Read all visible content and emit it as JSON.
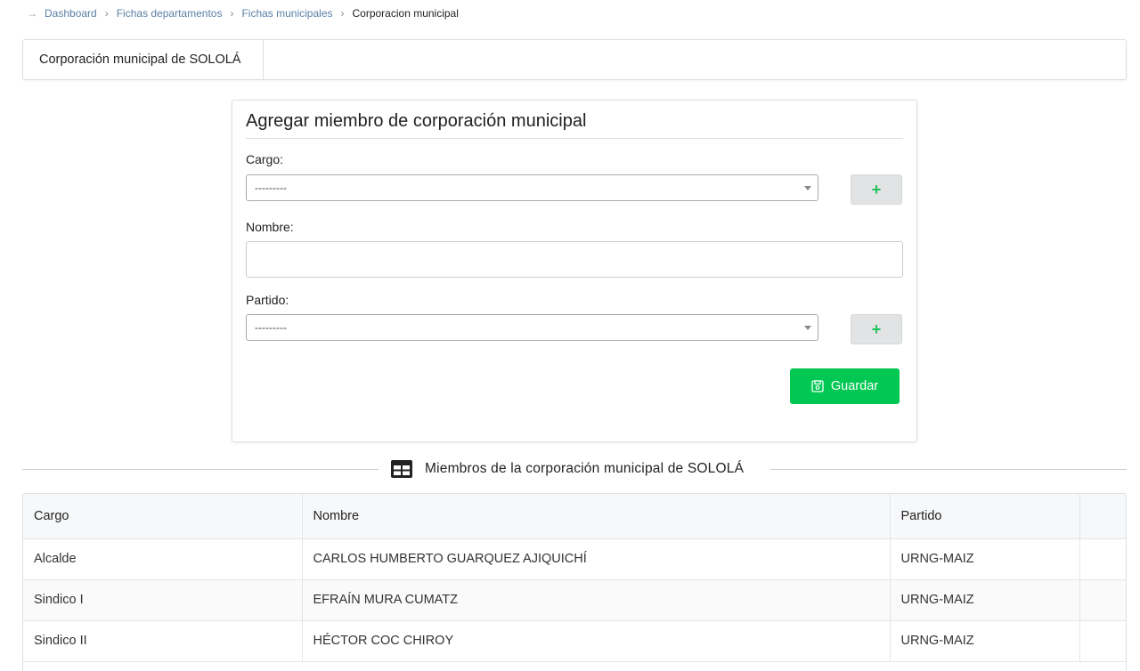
{
  "breadcrumb": {
    "items": [
      "Dashboard",
      "Fichas departamentos",
      "Fichas municipales"
    ],
    "current": "Corporacion municipal"
  },
  "header": {
    "title": "Corporación municipal de SOLOLÁ"
  },
  "form": {
    "title": "Agregar miembro de corporación municipal",
    "cargo_label": "Cargo:",
    "cargo_value": "---------",
    "nombre_label": "Nombre:",
    "nombre_value": "",
    "partido_label": "Partido:",
    "partido_value": "---------",
    "add_icon": "plus-icon",
    "save_label": "Guardar",
    "save_icon": "floppy-disk-icon",
    "accent_color": "#00c853"
  },
  "members": {
    "title": "Miembros de la corporación municipal de SOLOLÁ",
    "icon": "table-icon",
    "columns": [
      "Cargo",
      "Nombre",
      "Partido",
      ""
    ],
    "rows": [
      {
        "cargo": "Alcalde",
        "nombre": "CARLOS HUMBERTO GUARQUEZ AJIQUICHÍ",
        "partido": "URNG-MAIZ"
      },
      {
        "cargo": "Sindico I",
        "nombre": "EFRAÍN MURA CUMATZ",
        "partido": "URNG-MAIZ"
      },
      {
        "cargo": "Sindico II",
        "nombre": "HÉCTOR COC CHIROY",
        "partido": "URNG-MAIZ"
      }
    ]
  }
}
